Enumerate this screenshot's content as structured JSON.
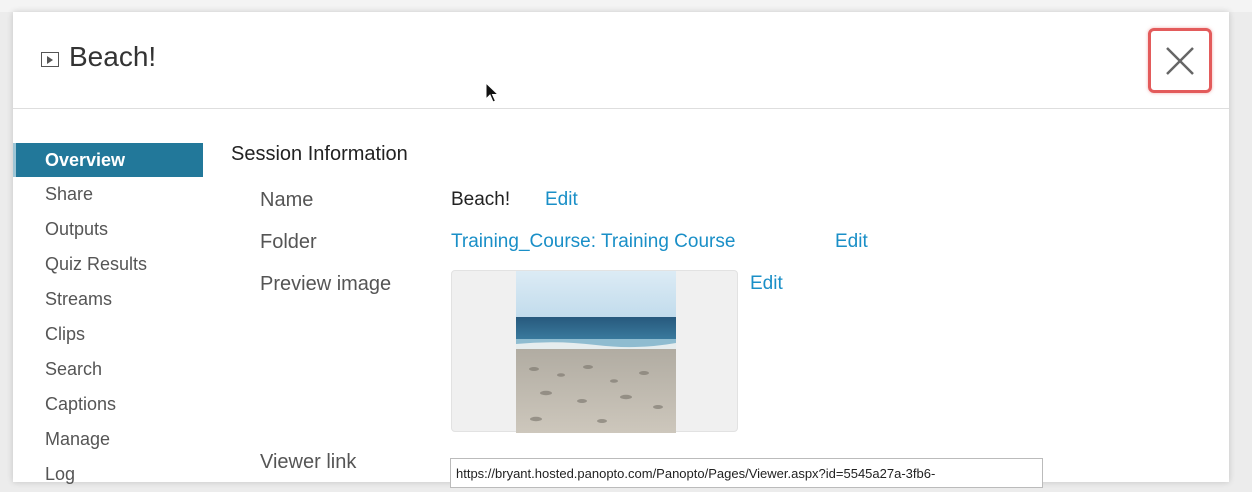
{
  "header": {
    "title": "Beach!",
    "play_icon": "play-icon",
    "close_icon": "close-icon"
  },
  "sidebar": {
    "items": [
      {
        "label": "Overview",
        "active": true
      },
      {
        "label": "Share"
      },
      {
        "label": "Outputs"
      },
      {
        "label": "Quiz Results"
      },
      {
        "label": "Streams"
      },
      {
        "label": "Clips"
      },
      {
        "label": "Search"
      },
      {
        "label": "Captions"
      },
      {
        "label": "Manage"
      },
      {
        "label": "Log"
      }
    ]
  },
  "session": {
    "title": "Session Information",
    "name_label": "Name",
    "name_value": "Beach!",
    "name_edit": "Edit",
    "folder_label": "Folder",
    "folder_value": "Training_Course: Training Course",
    "folder_edit": "Edit",
    "preview_label": "Preview image",
    "preview_edit": "Edit",
    "viewer_label": "Viewer link",
    "viewer_url": "https://bryant.hosted.panopto.com/Panopto/Pages/Viewer.aspx?id=5545a27a-3fb6-"
  },
  "colors": {
    "accent": "#22789a",
    "link": "#1a8fc7",
    "close_highlight": "#e35b5b"
  }
}
